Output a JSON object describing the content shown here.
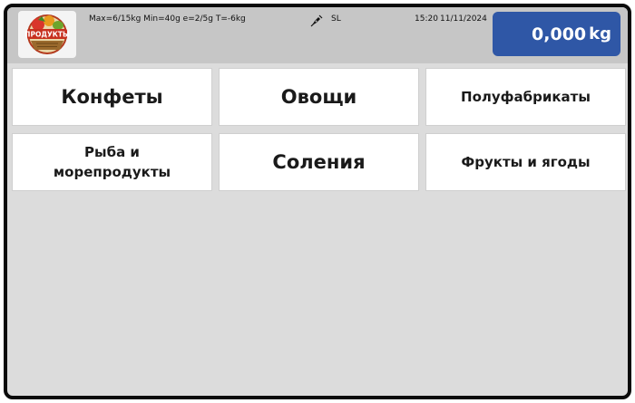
{
  "header": {
    "logo_text": "ПРОДУКТЫ",
    "scale_info": "Max=6/15kg Min=40g e=2/5g T=-6kg",
    "stable_icon": "pen-nib-icon",
    "mode": "SL",
    "time": "15:20",
    "date": "11/11/2024",
    "weight_value": "0,000",
    "weight_unit": "kg"
  },
  "colors": {
    "header_bg": "#c6c6c6",
    "body_bg": "#dcdcdc",
    "weight_bg": "#2f57a6",
    "tile_bg": "#ffffff"
  },
  "categories": [
    {
      "label": "Конфеты"
    },
    {
      "label": "Овощи"
    },
    {
      "label": "Полуфабрикаты"
    },
    {
      "label_line1": "Рыба и",
      "label_line2": "морепродукты"
    },
    {
      "label": "Соления"
    },
    {
      "label": "Фрукты и ягоды"
    }
  ]
}
